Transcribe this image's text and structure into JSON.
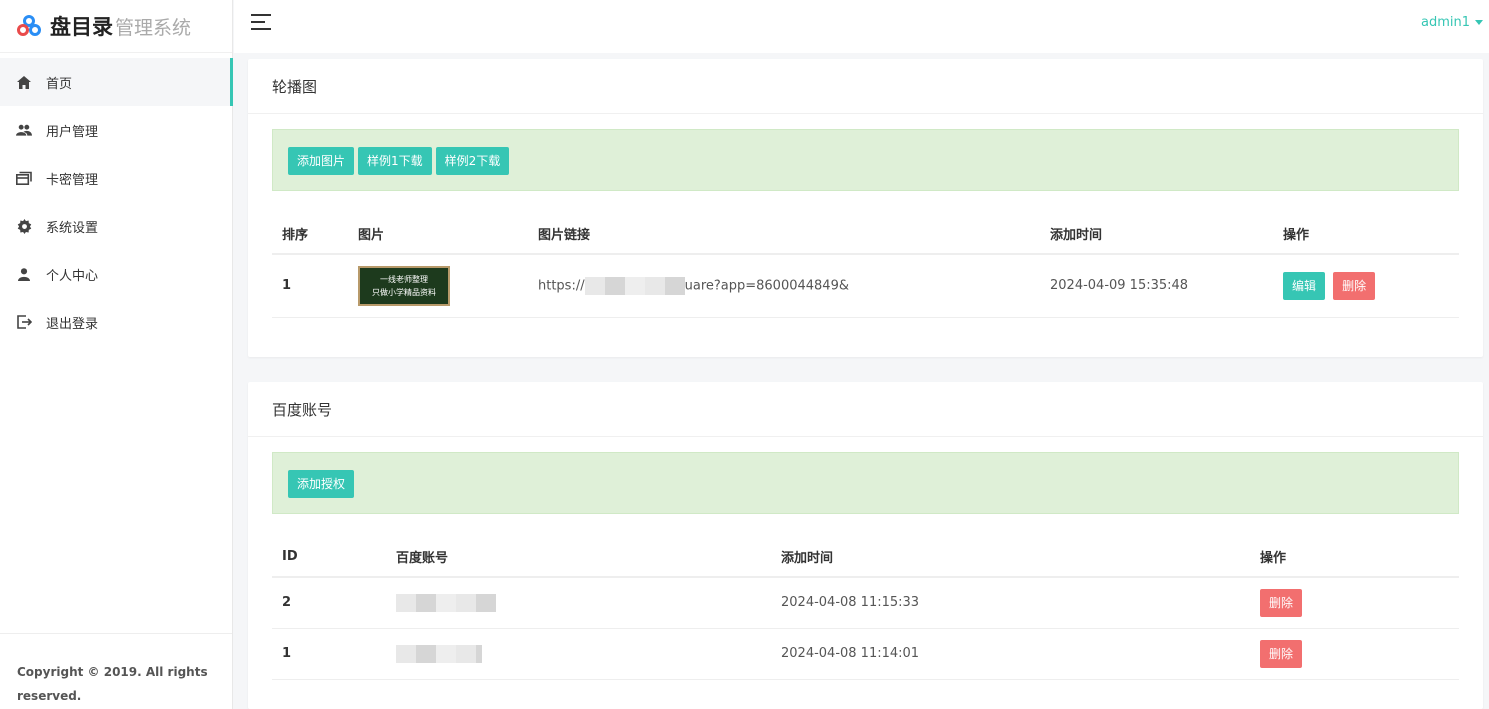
{
  "brand": {
    "title": "盘目录",
    "subtitle": "管理系统"
  },
  "sidebar": {
    "items": [
      {
        "label": "首页",
        "icon": "home-icon",
        "active": true
      },
      {
        "label": "用户管理",
        "icon": "users-icon"
      },
      {
        "label": "卡密管理",
        "icon": "cards-icon"
      },
      {
        "label": "系统设置",
        "icon": "gear-icon"
      },
      {
        "label": "个人中心",
        "icon": "person-icon"
      },
      {
        "label": "退出登录",
        "icon": "logout-icon"
      }
    ],
    "footer": "Copyright © 2019. All rights reserved."
  },
  "header": {
    "user": "admin1"
  },
  "carousel": {
    "title": "轮播图",
    "buttons": [
      "添加图片",
      "样例1下载",
      "样例2下载"
    ],
    "columns": [
      "排序",
      "图片",
      "图片链接",
      "添加时间",
      "操作"
    ],
    "rows": [
      {
        "order": "1",
        "image_text_1": "一线老师整理",
        "image_text_2": "只做小学精品资料",
        "link_prefix": "https://",
        "link_suffix": "uare?app=8600044849&",
        "time": "2024-04-09 15:35:48",
        "edit": "编辑",
        "delete": "删除"
      }
    ]
  },
  "baidu": {
    "title": "百度账号",
    "buttons": [
      "添加授权"
    ],
    "columns": [
      "ID",
      "百度账号",
      "添加时间",
      "操作"
    ],
    "rows": [
      {
        "id": "2",
        "time": "2024-04-08 11:15:33",
        "delete": "删除"
      },
      {
        "id": "1",
        "time": "2024-04-08 11:14:01",
        "delete": "删除"
      }
    ]
  },
  "colors": {
    "accent": "#36c6b4",
    "danger": "#f26f6f",
    "toolbar_bg": "#dff0d8"
  }
}
